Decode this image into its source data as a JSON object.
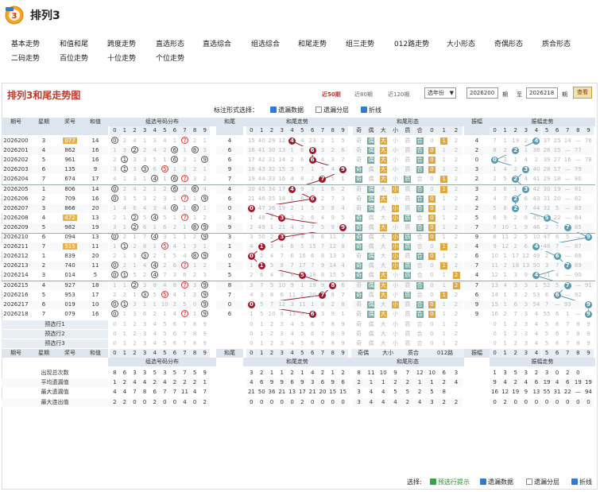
{
  "app": {
    "title": "排列3",
    "logo_text": "排列3"
  },
  "nav": {
    "row1": [
      "基本走势",
      "和值和尾",
      "跨度走势",
      "直选形态",
      "直选综合",
      "组选综合",
      "和尾走势",
      "组三走势",
      "012路走势",
      "大小形态",
      "奇偶形态",
      "质合形态"
    ],
    "row2": [
      "二码走势",
      "百位走势",
      "十位走势",
      "个位走势"
    ]
  },
  "panel": {
    "title": "排列3和尾走势图",
    "quick": [
      "近50期",
      "近80期",
      "近120期"
    ],
    "year_select": "选年份",
    "from": "2026200",
    "to": "2026218",
    "from_label": "期",
    "to_label": "至",
    "to_suffix": "期",
    "query": "查看"
  },
  "options": {
    "label": "标注形式选择：",
    "items": [
      {
        "text": "遗漏数据",
        "checked": true
      },
      {
        "text": "遗漏分层",
        "checked": false
      },
      {
        "text": "折线",
        "checked": true
      }
    ]
  },
  "headers": {
    "issue": "期号",
    "week": "星期",
    "number": "奖号",
    "sum": "和值",
    "dist": "组选号码分布",
    "tail": "和尾",
    "tailtrend": "和尾走势",
    "form": "和尾形态",
    "jiou": "奇偶",
    "daxiao": "大小",
    "zhihe": "质合",
    "r012": "012路",
    "span": "振幅",
    "spantrend": "振幅走势",
    "digits": [
      "0",
      "1",
      "2",
      "3",
      "4",
      "5",
      "6",
      "7",
      "8",
      "9"
    ],
    "ji": "奇",
    "ou": "偶",
    "da": "大",
    "xiao": "小",
    "zhi": "质",
    "he": "合",
    "r0": "0",
    "r1": "1",
    "r2": "2"
  },
  "rows": [
    {
      "issue": "2026200",
      "week": "3",
      "num": "077",
      "sum": "14",
      "dist": [
        "0",
        "2",
        "4",
        "1",
        "3",
        "4",
        "1",
        "7",
        "2",
        "1"
      ],
      "distmark": [
        0,
        7
      ],
      "tail": "4",
      "tt": [
        "15",
        "40",
        "29",
        "12",
        "4",
        "4",
        "23",
        "2",
        "1",
        "5"
      ],
      "form": [
        "偶",
        "大",
        "合",
        "1"
      ],
      "span": "4",
      "sp": [
        "7",
        "1",
        "19",
        "2",
        "4",
        "37",
        "25",
        "14",
        "—",
        "76"
      ]
    },
    {
      "issue": "2026201",
      "week": "4",
      "num": "862",
      "sum": "16",
      "dist": [
        "1",
        "3",
        "2",
        "2",
        "4",
        "2",
        "6",
        "1",
        "8",
        "3"
      ],
      "distmark": [
        2,
        6,
        8
      ],
      "tail": "6",
      "tt": [
        "16",
        "41",
        "30",
        "13",
        "1",
        "6",
        "24",
        "3",
        "2",
        "6"
      ],
      "form": [
        "偶",
        "大",
        "合",
        "0"
      ],
      "span": "2",
      "sp": [
        "8",
        "2",
        "2",
        "1",
        "38",
        "26",
        "15",
        "—",
        "77"
      ]
    },
    {
      "issue": "2026202",
      "week": "5",
      "num": "961",
      "sum": "16",
      "dist": [
        "2",
        "1",
        "3",
        "3",
        "5",
        "1",
        "6",
        "2",
        "1",
        "9"
      ],
      "distmark": [
        1,
        6,
        9
      ],
      "tail": "6",
      "tt": [
        "17",
        "42",
        "31",
        "14",
        "2",
        "6",
        "25",
        "4",
        "3",
        "7"
      ],
      "form": [
        "偶",
        "大",
        "合",
        "0"
      ],
      "span": "0",
      "sp": [
        "0",
        "3",
        "1",
        "4",
        "2",
        "39",
        "27",
        "16",
        "—",
        "78"
      ]
    },
    {
      "issue": "2026203",
      "week": "6",
      "num": "135",
      "sum": "9",
      "dist": [
        "3",
        "1",
        "3",
        "3",
        "6",
        "5",
        "1",
        "3",
        "2",
        "1"
      ],
      "distmark": [
        1,
        3,
        5
      ],
      "tail": "9",
      "tt": [
        "18",
        "43",
        "32",
        "15",
        "3",
        "7",
        "1",
        "5",
        "4",
        "9"
      ],
      "form": [
        "奇",
        "大",
        "合",
        "0"
      ],
      "span": "3",
      "sp": [
        "1",
        "4",
        "2",
        "3",
        "40",
        "28",
        "17",
        "—",
        "79"
      ]
    },
    {
      "issue": "2026204",
      "week": "7",
      "num": "674",
      "sum": "17",
      "dist": [
        "4",
        "1",
        "3",
        "1",
        "4",
        "1",
        "6",
        "7",
        "3",
        "2"
      ],
      "distmark": [
        4,
        6,
        7
      ],
      "tail": "7",
      "tt": [
        "19",
        "44",
        "33",
        "16",
        "4",
        "8",
        "2",
        "7",
        "5",
        "1"
      ],
      "form": [
        "奇",
        "大",
        "质",
        "1"
      ],
      "span": "2",
      "sp": [
        "2",
        "5",
        "1",
        "4",
        "41",
        "29",
        "18",
        "—",
        "80"
      ]
    },
    {
      "issue": "2026205",
      "week": "1",
      "num": "806",
      "sum": "14",
      "dist": [
        "0",
        "2",
        "4",
        "2",
        "1",
        "2",
        "6",
        "3",
        "8",
        "4"
      ],
      "distmark": [
        0,
        6,
        8
      ],
      "tail": "4",
      "tt": [
        "20",
        "45",
        "34",
        "17",
        "4",
        "9",
        "3",
        "1",
        "6",
        "2"
      ],
      "form": [
        "偶",
        "小",
        "合",
        "1"
      ],
      "span": "3",
      "sp": [
        "3",
        "6",
        "1",
        "5",
        "42",
        "30",
        "19",
        "—",
        "81"
      ]
    },
    {
      "issue": "2026206",
      "week": "2",
      "num": "709",
      "sum": "16",
      "dist": [
        "0",
        "3",
        "5",
        "3",
        "2",
        "3",
        "1",
        "7",
        "1",
        "9"
      ],
      "distmark": [
        0,
        7,
        9
      ],
      "tail": "6",
      "tt": [
        "21",
        "46",
        "35",
        "18",
        "1",
        "6",
        "4",
        "2",
        "7",
        "3"
      ],
      "form": [
        "偶",
        "大",
        "合",
        "0"
      ],
      "span": "2",
      "sp": [
        "4",
        "7",
        "2",
        "6",
        "43",
        "31",
        "20",
        "—",
        "82"
      ]
    },
    {
      "issue": "2026207",
      "week": "3",
      "num": "866",
      "sum": "20",
      "dist": [
        "1",
        "4",
        "6",
        "4",
        "3",
        "4",
        "6",
        "1",
        "8",
        "1"
      ],
      "distmark": [
        6,
        8
      ],
      "tail": "0",
      "tt": [
        "0",
        "47",
        "36",
        "19",
        "2",
        "1",
        "5",
        "3",
        "8",
        "4"
      ],
      "form": [
        "偶",
        "小",
        "合",
        "0"
      ],
      "span": "2",
      "sp": [
        "5",
        "8",
        "3",
        "7",
        "44",
        "32",
        "5",
        "—",
        "83"
      ]
    },
    {
      "issue": "2026208",
      "week": "4",
      "num": "472",
      "sub": "",
      "sum": "13",
      "dist": [
        "2",
        "1",
        "7",
        "5",
        "4",
        "5",
        "1",
        "7",
        "1",
        "2"
      ],
      "distmark": [
        2,
        4,
        7
      ],
      "tail": "3",
      "tt": [
        "1",
        "48",
        "2",
        "20",
        "3",
        "2",
        "6",
        "4",
        "9",
        "5"
      ],
      "form": [
        "奇",
        "小",
        "质",
        "0"
      ],
      "span": "5",
      "sp": [
        "6",
        "9",
        "2",
        "8",
        "45",
        "1",
        "22",
        "—",
        "84"
      ]
    },
    {
      "issue": "2026209",
      "week": "5",
      "num": "982",
      "sum": "19",
      "dist": [
        "3",
        "1",
        "2",
        "6",
        "1",
        "6",
        "2",
        "1",
        "8",
        "9"
      ],
      "distmark": [
        2,
        8,
        9
      ],
      "tail": "9",
      "tt": [
        "2",
        "49",
        "1",
        "21",
        "4",
        "3",
        "7",
        "5",
        "9",
        "6"
      ],
      "form": [
        "奇",
        "大",
        "合",
        "0"
      ],
      "span": "7",
      "sp": [
        "7",
        "10",
        "1",
        "9",
        "46",
        "2",
        "7",
        "—",
        "85"
      ]
    },
    {
      "issue": "2026210",
      "week": "6",
      "num": "094",
      "sum": "13",
      "dist": [
        "0",
        "2",
        "1",
        "7",
        "4",
        "3",
        "1",
        "1",
        "2",
        "9"
      ],
      "distmark": [
        0,
        4,
        9
      ],
      "tail": "3",
      "tt": [
        "3",
        "50",
        "2",
        "3",
        "5",
        "4",
        "8",
        "6",
        "11",
        "7"
      ],
      "form": [
        "奇",
        "小",
        "质",
        "0"
      ],
      "span": "9",
      "sp": [
        "8",
        "11",
        "2",
        "5",
        "10",
        "47",
        "6",
        "5",
        "—",
        "86"
      ]
    },
    {
      "issue": "2026211",
      "week": "7",
      "num": "515",
      "sum": "11",
      "dist": [
        "1",
        "1",
        "2",
        "8",
        "1",
        "5",
        "4",
        "1",
        "3",
        "1"
      ],
      "distmark": [
        1,
        5
      ],
      "tail": "1",
      "tt": [
        "4",
        "1",
        "3",
        "4",
        "6",
        "5",
        "15",
        "7",
        "12",
        "8"
      ],
      "form": [
        "奇",
        "小",
        "质",
        "1"
      ],
      "span": "4",
      "sp": [
        "9",
        "12",
        "2",
        "6",
        "11",
        "48",
        "7",
        "—",
        "87"
      ]
    },
    {
      "issue": "2026212",
      "week": "1",
      "num": "839",
      "sum": "20",
      "dist": [
        "2",
        "1",
        "3",
        "3",
        "2",
        "1",
        "5",
        "4",
        "8",
        "9"
      ],
      "distmark": [
        3,
        8,
        9
      ],
      "tail": "0",
      "tt": [
        "0",
        "2",
        "4",
        "7",
        "6",
        "16",
        "6",
        "8",
        "13",
        "3"
      ],
      "form": [
        "偶",
        "小",
        "合",
        "0"
      ],
      "span": "6",
      "sp": [
        "10",
        "1",
        "17",
        "12",
        "49",
        "2",
        "3",
        "—",
        "88"
      ]
    },
    {
      "issue": "2026213",
      "week": "2",
      "num": "740",
      "sum": "11",
      "dist": [
        "0",
        "2",
        "1",
        "4",
        "4",
        "2",
        "6",
        "7",
        "1",
        "2"
      ],
      "distmark": [
        0,
        4,
        7
      ],
      "tail": "1",
      "tt": [
        "1",
        "1",
        "5",
        "8",
        "7",
        "17",
        "7",
        "9",
        "14",
        "4"
      ],
      "form": [
        "奇",
        "小",
        "质",
        "1"
      ],
      "span": "7",
      "sp": [
        "11",
        "2",
        "18",
        "13",
        "50",
        "3",
        "7",
        "—",
        "89"
      ]
    },
    {
      "issue": "2026214",
      "week": "3",
      "num": "014",
      "sum": "5",
      "dist": [
        "0",
        "1",
        "5",
        "2",
        "4",
        "7",
        "3",
        "8",
        "2",
        "3"
      ],
      "distmark": [
        0,
        1,
        4
      ],
      "tail": "5",
      "tt": [
        "2",
        "6",
        "4",
        "9",
        "8",
        "5",
        "18",
        "8",
        "15",
        "5"
      ],
      "form": [
        "奇",
        "大",
        "质",
        "2"
      ],
      "span": "4",
      "sp": [
        "12",
        "1",
        "3",
        "9",
        "4",
        "51",
        "4",
        "—",
        "90"
      ]
    },
    {
      "issue": "2026215",
      "week": "4",
      "num": "927",
      "sum": "18",
      "dist": [
        "1",
        "1",
        "2",
        "3",
        "8",
        "4",
        "8",
        "7",
        "3",
        "9"
      ],
      "distmark": [
        2,
        7,
        9
      ],
      "tail": "8",
      "tt": [
        "3",
        "7",
        "5",
        "10",
        "9",
        "1",
        "19",
        "9",
        "8",
        "6"
      ],
      "form": [
        "偶",
        "大",
        "合",
        "2"
      ],
      "span": "7",
      "sp": [
        "13",
        "4",
        "3",
        "3",
        "1",
        "52",
        "5",
        "6",
        "—",
        "91"
      ]
    },
    {
      "issue": "2026216",
      "week": "5",
      "num": "953",
      "sum": "17",
      "dist": [
        "2",
        "2",
        "1",
        "3",
        "5",
        "5",
        "4",
        "1",
        "3",
        "9"
      ],
      "distmark": [
        3,
        5,
        9
      ],
      "tail": "7",
      "tt": [
        "4",
        "3",
        "8",
        "6",
        "11",
        "2",
        "20",
        "7",
        "8",
        "7"
      ],
      "form": [
        "奇",
        "大",
        "质",
        "1"
      ],
      "span": "6",
      "sp": [
        "14",
        "1",
        "3",
        "2",
        "53",
        "6",
        "1",
        "—",
        "92"
      ]
    },
    {
      "issue": "2026217",
      "week": "6",
      "num": "019",
      "sum": "10",
      "dist": [
        "0",
        "1",
        "3",
        "1",
        "1",
        "10",
        "2",
        "5",
        "0",
        "9"
      ],
      "distmark": [
        0,
        1,
        9
      ],
      "tail": "0",
      "tt": [
        "0",
        "5",
        "7",
        "12",
        "3",
        "11",
        "1",
        "8",
        "2",
        "8"
      ],
      "form": [
        "偶",
        "小",
        "合",
        "0"
      ],
      "span": "9",
      "sp": [
        "15",
        "1",
        "6",
        "3",
        "54",
        "7",
        "—",
        "93"
      ]
    },
    {
      "issue": "2026218",
      "week": "7",
      "num": "079",
      "sum": "16",
      "dist": [
        "0",
        "1",
        "3",
        "6",
        "2",
        "1",
        "4",
        "7",
        "1",
        "9"
      ],
      "distmark": [
        0,
        7,
        9
      ],
      "tail": "6",
      "tt": [
        "1",
        "5",
        "10",
        "8",
        "13",
        "6",
        "9",
        "3",
        "9",
        "1"
      ],
      "form": [
        "偶",
        "大",
        "合",
        "0"
      ],
      "span": "9",
      "sp": [
        "16",
        "2",
        "7",
        "3",
        "4",
        "55",
        "6",
        "1",
        "—",
        "94"
      ]
    }
  ],
  "predict": [
    "预选行1",
    "预选行2",
    "预选行3"
  ],
  "stats": {
    "labels": [
      "出现总次数",
      "平均遗漏值",
      "最大遗漏值",
      "最大连出值"
    ],
    "dist": [
      [
        "8",
        "6",
        "3",
        "3",
        "5",
        "3",
        "5",
        "7",
        "5",
        "9"
      ],
      [
        "1",
        "2",
        "4",
        "4",
        "2",
        "4",
        "2",
        "2",
        "2",
        "1"
      ],
      [
        "4",
        "4",
        "7",
        "8",
        "6",
        "7",
        "7",
        "11",
        "4",
        "7",
        "3"
      ],
      [
        "2",
        "2",
        "0",
        "0",
        "2",
        "0",
        "0",
        "4",
        "0",
        "2"
      ]
    ],
    "tt": [
      [
        "3",
        "2",
        "1",
        "1",
        "2",
        "1",
        "4",
        "2",
        "1",
        "2"
      ],
      [
        "4",
        "6",
        "9",
        "9",
        "6",
        "9",
        "3",
        "6",
        "9",
        "6"
      ],
      [
        "21",
        "50",
        "36",
        "21",
        "13",
        "17",
        "21",
        "20",
        "15",
        "15"
      ],
      [
        "0",
        "0",
        "0",
        "0",
        "0",
        "2",
        "0",
        "0",
        "0",
        "0"
      ]
    ],
    "form": [
      [
        "8",
        "11",
        "10",
        "9",
        "7",
        "12",
        "10",
        "6",
        "3"
      ],
      [
        "2",
        "1",
        "1",
        "2",
        "2",
        "1",
        "1",
        "2",
        "4"
      ],
      [
        "3",
        "4",
        "4",
        "5",
        "5",
        "2",
        "5",
        "8"
      ],
      [
        "3",
        "4",
        "4",
        "4",
        "2",
        "4",
        "3",
        "2",
        "2"
      ]
    ],
    "sp": [
      [
        "1",
        "3",
        "5",
        "3",
        "2",
        "3",
        "0",
        "2",
        "0"
      ],
      [
        "9",
        "4",
        "2",
        "4",
        "6",
        "19",
        "4",
        "6",
        "19",
        "19"
      ],
      [
        "16",
        "12",
        "19",
        "9",
        "13",
        "55",
        "31",
        "22",
        "—",
        "94"
      ],
      [
        "0",
        "2",
        "0",
        "0",
        "0",
        "0",
        "0",
        "0",
        "0",
        "0"
      ]
    ]
  },
  "footer": {
    "label": "选择:",
    "items": [
      {
        "text": "预选行提示",
        "checked": true,
        "green": true
      },
      {
        "text": "遗漏数据",
        "checked": true
      },
      {
        "text": "遗漏分层",
        "checked": false
      },
      {
        "text": "折线",
        "checked": true
      }
    ]
  }
}
